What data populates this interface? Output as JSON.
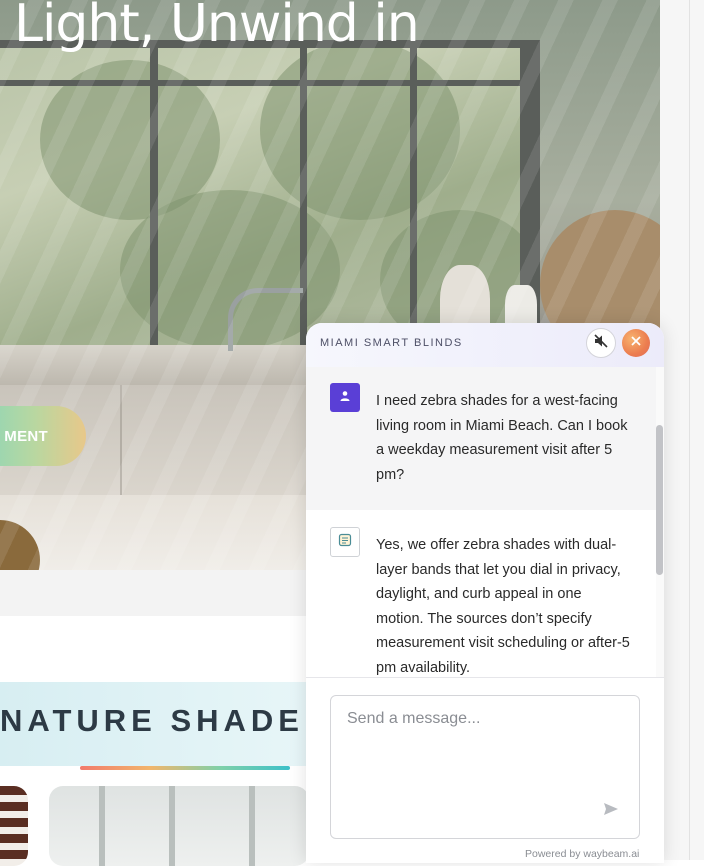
{
  "hero": {
    "title": "Light, Unwind in",
    "cta_label": "MENT"
  },
  "section": {
    "title": "NATURE SHADE"
  },
  "chat": {
    "brand": "MIAMI SMART BLINDS",
    "messages": [
      {
        "role": "user",
        "text": "I need zebra shades for a west-facing living room in Miami Beach. Can I book a weekday measurement visit after 5 pm?"
      },
      {
        "role": "assistant",
        "text": "Yes, we offer zebra shades with dual-layer bands that let you dial in privacy, daylight, and curb appeal in one motion. The sources don’t specify measurement visit scheduling or after-5 pm availability."
      }
    ],
    "input_placeholder": "Send a message...",
    "powered_by": "Powered by waybeam.ai"
  },
  "icons": {
    "mute": "speaker-muted-icon",
    "close": "close-icon",
    "user_avatar": "user-icon",
    "bot_avatar": "document-icon",
    "send": "send-icon"
  },
  "colors": {
    "user_avatar_bg": "#5a3fd6",
    "close_gradient_start": "#f7b36f",
    "close_gradient_end": "#e06a57"
  }
}
